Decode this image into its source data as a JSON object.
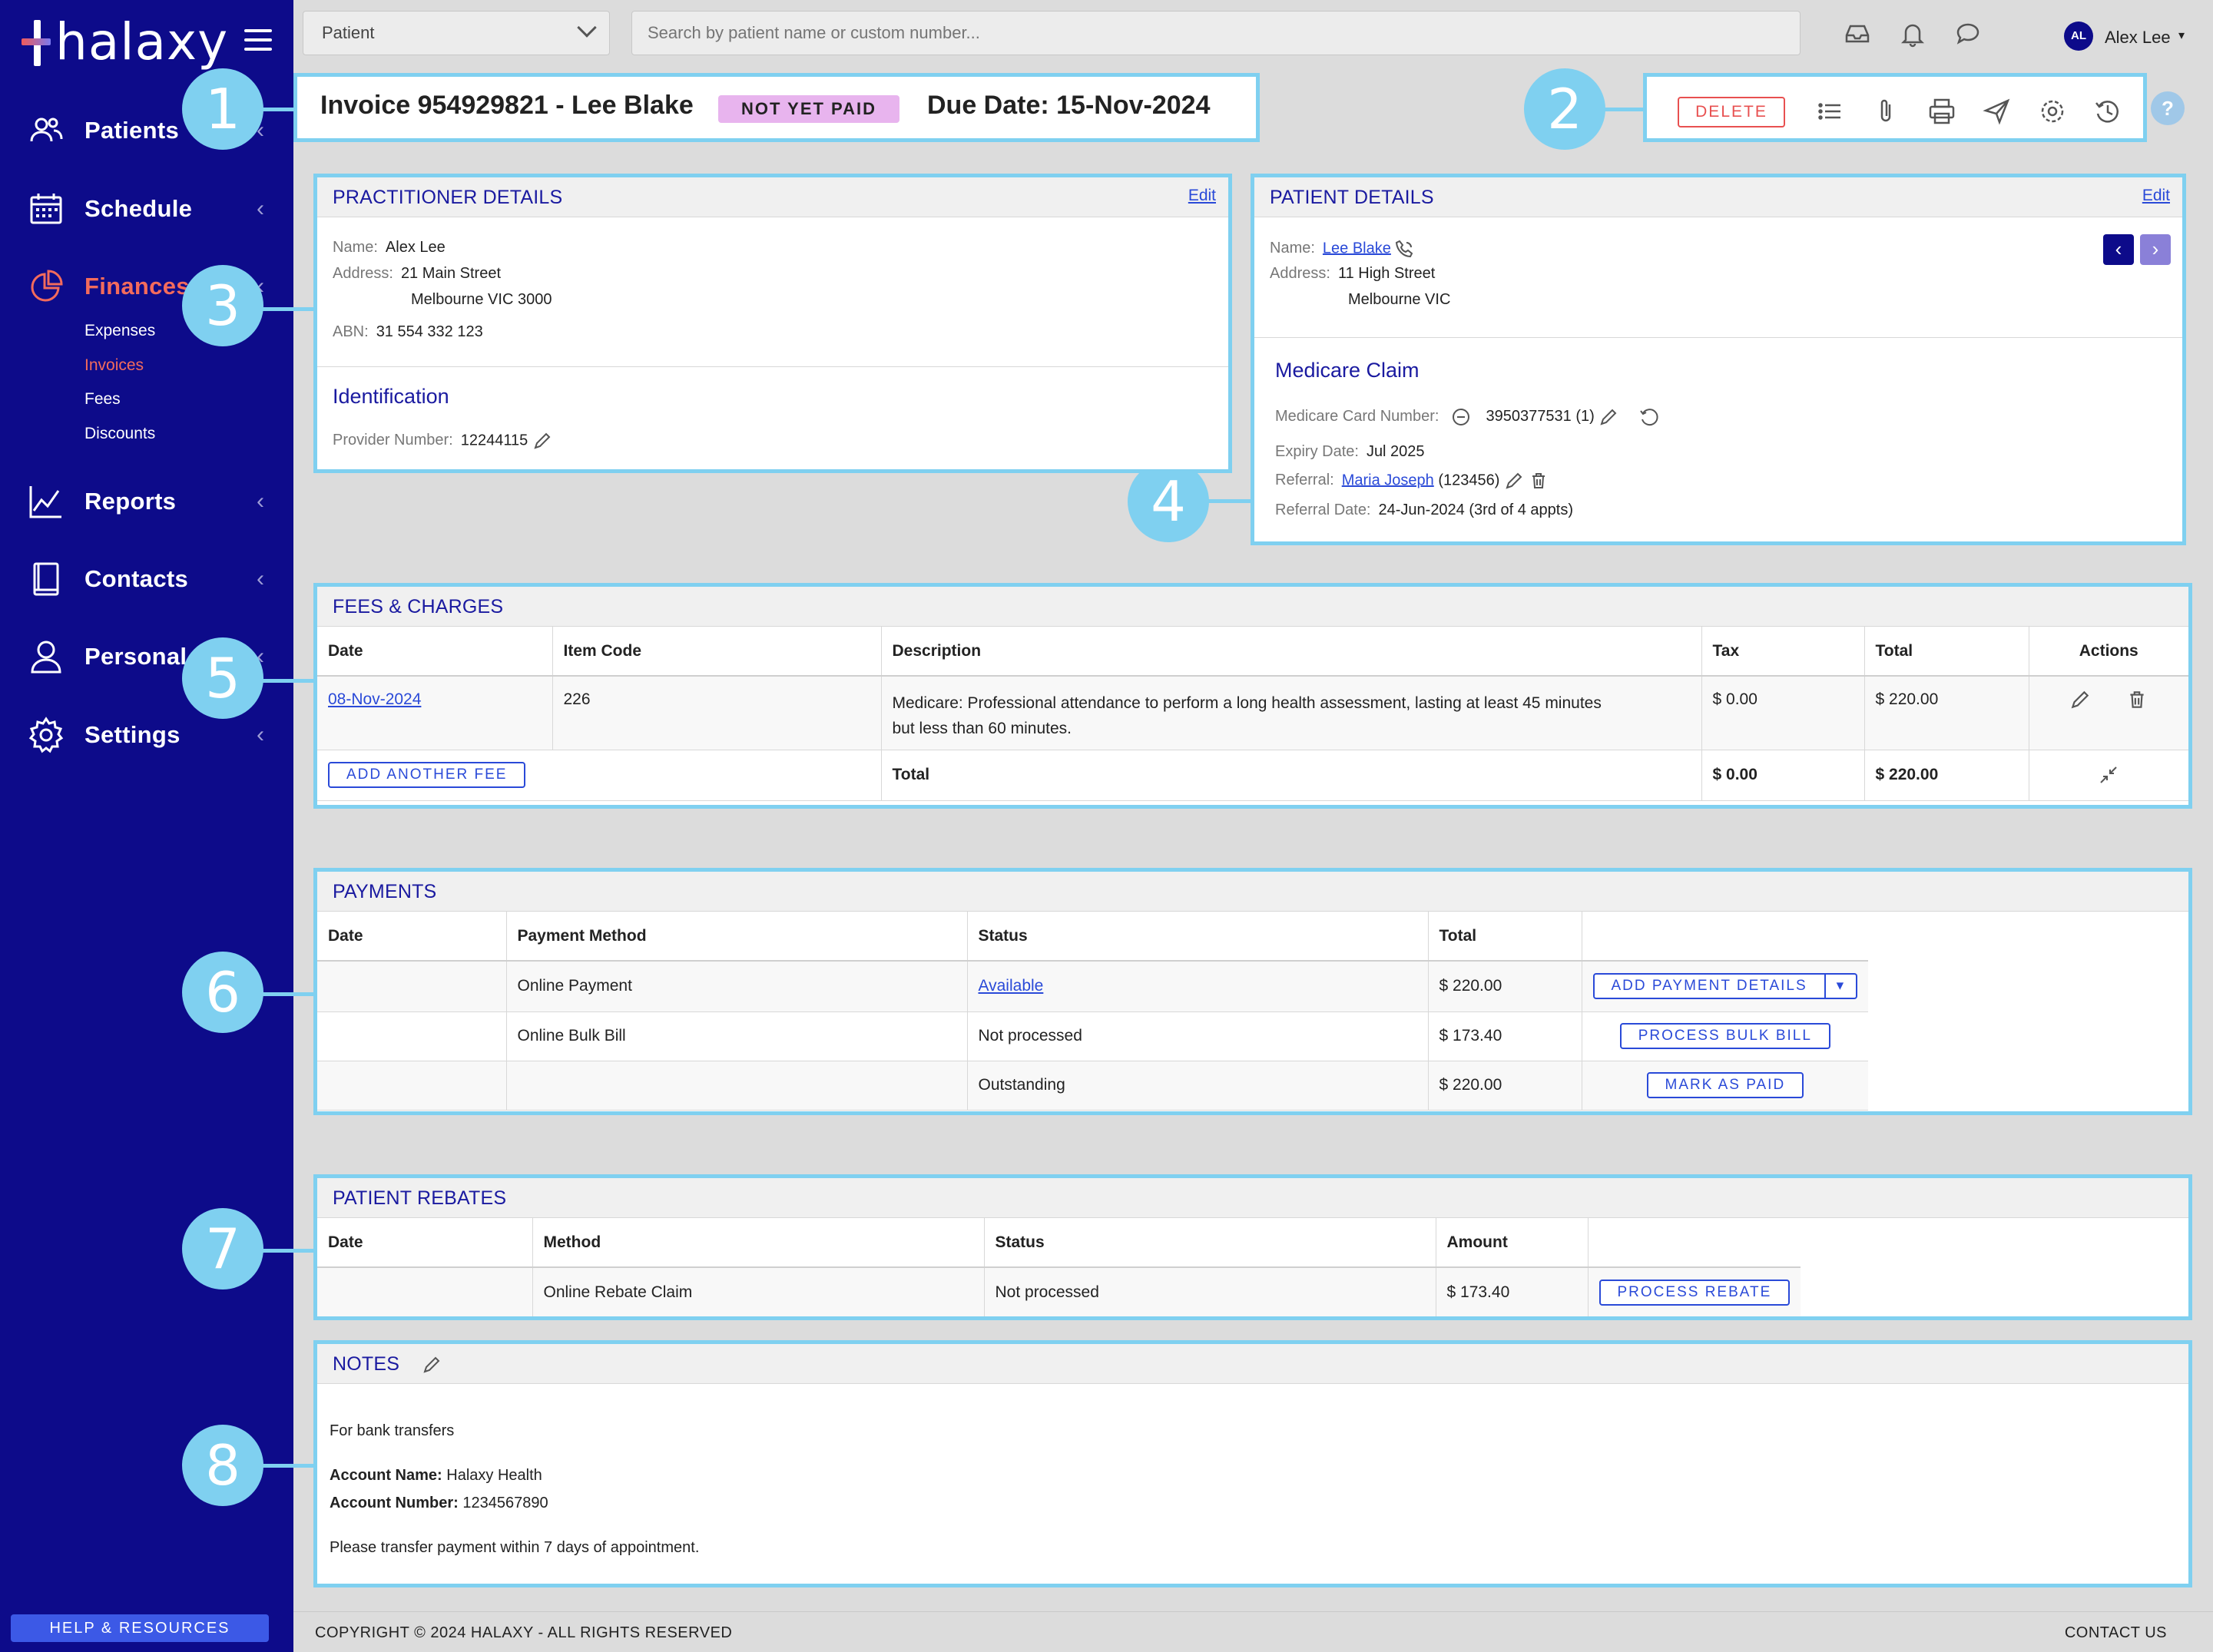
{
  "app": {
    "logo": "halaxy"
  },
  "sidebar": {
    "items": [
      {
        "label": "Patients",
        "icon": "users-icon"
      },
      {
        "label": "Schedule",
        "icon": "calendar-icon"
      },
      {
        "label": "Finances",
        "icon": "pie-chart-icon",
        "active": true,
        "sub": [
          {
            "label": "Expenses"
          },
          {
            "label": "Invoices",
            "active": true
          },
          {
            "label": "Fees"
          },
          {
            "label": "Discounts"
          }
        ]
      },
      {
        "label": "Reports",
        "icon": "line-chart-icon"
      },
      {
        "label": "Contacts",
        "icon": "book-icon"
      },
      {
        "label": "Personal",
        "icon": "person-icon"
      },
      {
        "label": "Settings",
        "icon": "gear-icon"
      }
    ],
    "help_label": "HELP & RESOURCES"
  },
  "topbar": {
    "patient_select": "Patient",
    "search_placeholder": "Search by patient name or custom number...",
    "user_initials": "AL",
    "user_name": "Alex Lee"
  },
  "invoice": {
    "title": "Invoice 954929821 - Lee Blake",
    "status": "NOT YET PAID",
    "due": "Due Date: 15-Nov-2024"
  },
  "toolbar": {
    "delete_label": "DELETE",
    "help": "?"
  },
  "callouts": [
    "1",
    "2",
    "3",
    "4",
    "5",
    "6",
    "7",
    "8"
  ],
  "practitioner": {
    "title": "PRACTITIONER DETAILS",
    "edit": "Edit",
    "name_k": "Name:",
    "name_v": "Alex Lee",
    "address_k": "Address:",
    "address_1": "21 Main Street",
    "address_2": "Melbourne VIC 3000",
    "abn_k": "ABN:",
    "abn_v": "31 554 332 123",
    "ident_title": "Identification",
    "provider_k": "Provider Number:",
    "provider_v": "12244115"
  },
  "patient": {
    "title": "PATIENT DETAILS",
    "edit": "Edit",
    "name_k": "Name:",
    "name_v": "Lee Blake",
    "address_k": "Address:",
    "address_1": "11 High Street",
    "address_2": "Melbourne VIC",
    "medicare_title": "Medicare Claim",
    "card_k": "Medicare Card Number:",
    "card_v": "3950377531 (1)",
    "expiry_k": "Expiry Date:",
    "expiry_v": "Jul 2025",
    "referral_k": "Referral:",
    "referral_name": "Maria Joseph",
    "referral_id": "(123456)",
    "refdate_k": "Referral Date:",
    "refdate_v": "24-Jun-2024 (3rd of 4 appts)"
  },
  "fees": {
    "title": "FEES & CHARGES",
    "headers": [
      "Date",
      "Item Code",
      "Description",
      "Tax",
      "Total",
      "Actions"
    ],
    "row": {
      "date": "08-Nov-2024",
      "code": "226",
      "desc_1": "Medicare: Professional attendance to perform a long health assessment, lasting at least 45 minutes",
      "desc_2": "but less than 60 minutes.",
      "tax": "$ 0.00",
      "total": "$ 220.00"
    },
    "add_label": "ADD ANOTHER FEE",
    "total_label": "Total",
    "total_tax": "$ 0.00",
    "total_total": "$ 220.00"
  },
  "payments": {
    "title": "PAYMENTS",
    "headers": [
      "Date",
      "Payment Method",
      "Status",
      "Total",
      ""
    ],
    "rows": [
      {
        "date": "",
        "method": "Online Payment",
        "status": "Available",
        "total": "$ 220.00",
        "action": "ADD PAYMENT DETAILS"
      },
      {
        "date": "",
        "method": "Online Bulk Bill",
        "status": "Not processed",
        "total": "$ 173.40",
        "action": "PROCESS BULK BILL"
      },
      {
        "date": "",
        "method": "",
        "status": "Outstanding",
        "total": "$ 220.00",
        "action": "MARK AS PAID"
      }
    ]
  },
  "rebates": {
    "title": "PATIENT REBATES",
    "headers": [
      "Date",
      "Method",
      "Status",
      "Amount",
      ""
    ],
    "row": {
      "date": "",
      "method": "Online Rebate Claim",
      "status": "Not processed",
      "amount": "$ 173.40",
      "action": "PROCESS REBATE"
    }
  },
  "notes": {
    "title": "NOTES",
    "line1": "For bank transfers",
    "acct_name_k": "Account Name:",
    "acct_name_v": "Halaxy Health",
    "acct_num_k": "Account Number:",
    "acct_num_v": "1234567890",
    "line3": "Please transfer payment within 7 days of appointment."
  },
  "footer": {
    "copyright": "COPYRIGHT © 2024 HALAXY - ALL RIGHTS RESERVED",
    "contact": "CONTACT US"
  },
  "colors": {
    "sidebar": "#0d0b8a",
    "accent_red": "#f36b5c",
    "callout": "#7fd0f0",
    "link": "#2a4ad8",
    "status_badge": "#e8b4ee"
  }
}
